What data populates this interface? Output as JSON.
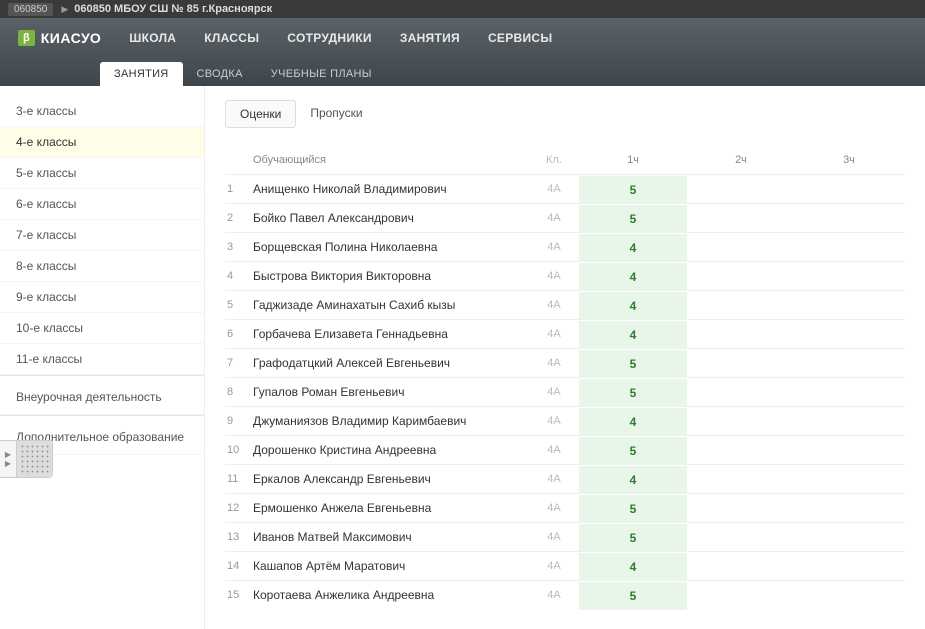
{
  "topbar": {
    "code": "060850",
    "title": "060850 МБОУ СШ № 85 г.Красноярск"
  },
  "logo": {
    "badge": "β",
    "text": "КИАСУО"
  },
  "nav": [
    {
      "label": "ШКОЛА"
    },
    {
      "label": "КЛАССЫ"
    },
    {
      "label": "СОТРУДНИКИ"
    },
    {
      "label": "ЗАНЯТИЯ"
    },
    {
      "label": "СЕРВИСЫ"
    }
  ],
  "subnav": [
    {
      "label": "ЗАНЯТИЯ",
      "active": true
    },
    {
      "label": "СВОДКА"
    },
    {
      "label": "УЧЕБНЫЕ ПЛАНЫ"
    }
  ],
  "sidebar": {
    "items": [
      {
        "label": "3-е классы"
      },
      {
        "label": "4-е классы",
        "active": true
      },
      {
        "label": "5-е классы"
      },
      {
        "label": "6-е классы"
      },
      {
        "label": "7-е классы"
      },
      {
        "label": "8-е классы"
      },
      {
        "label": "9-е классы"
      },
      {
        "label": "10-е классы"
      },
      {
        "label": "11-е классы"
      }
    ],
    "sections": [
      {
        "label": "Внеурочная деятельность"
      },
      {
        "label": "Дополнительное образование"
      }
    ]
  },
  "content_tabs": [
    {
      "label": "Оценки",
      "active": true
    },
    {
      "label": "Пропуски"
    }
  ],
  "table": {
    "headers": {
      "name": "Обучающийся",
      "class": "Кл.",
      "h1": "1ч",
      "h2": "2ч",
      "h3": "3ч"
    },
    "rows": [
      {
        "num": "1",
        "name": "Анищенко Николай Владимирович",
        "class": "4А",
        "g1": "5"
      },
      {
        "num": "2",
        "name": "Бойко Павел Александрович",
        "class": "4А",
        "g1": "5"
      },
      {
        "num": "3",
        "name": "Борщевская Полина Николаевна",
        "class": "4А",
        "g1": "4"
      },
      {
        "num": "4",
        "name": "Быстрова Виктория Викторовна",
        "class": "4А",
        "g1": "4"
      },
      {
        "num": "5",
        "name": "Гаджизаде Аминахатын Сахиб кызы",
        "class": "4А",
        "g1": "4"
      },
      {
        "num": "6",
        "name": "Горбачева Елизавета Геннадьевна",
        "class": "4А",
        "g1": "4"
      },
      {
        "num": "7",
        "name": "Графодатцкий Алексей Евгеньевич",
        "class": "4А",
        "g1": "5"
      },
      {
        "num": "8",
        "name": "Гупалов Роман Евгеньевич",
        "class": "4А",
        "g1": "5"
      },
      {
        "num": "9",
        "name": "Джуманиязов Владимир Каримбаевич",
        "class": "4А",
        "g1": "4"
      },
      {
        "num": "10",
        "name": "Дорошенко Кристина Андреевна",
        "class": "4А",
        "g1": "5"
      },
      {
        "num": "11",
        "name": "Еркалов Александр Евгеньевич",
        "class": "4А",
        "g1": "4"
      },
      {
        "num": "12",
        "name": "Ермошенко Анжела Евгеньевна",
        "class": "4А",
        "g1": "5"
      },
      {
        "num": "13",
        "name": "Иванов Матвей Максимович",
        "class": "4А",
        "g1": "5"
      },
      {
        "num": "14",
        "name": "Кашапов Артём Маратович",
        "class": "4А",
        "g1": "4"
      },
      {
        "num": "15",
        "name": "Коротаева Анжелика Андреевна",
        "class": "4А",
        "g1": "5"
      }
    ]
  }
}
